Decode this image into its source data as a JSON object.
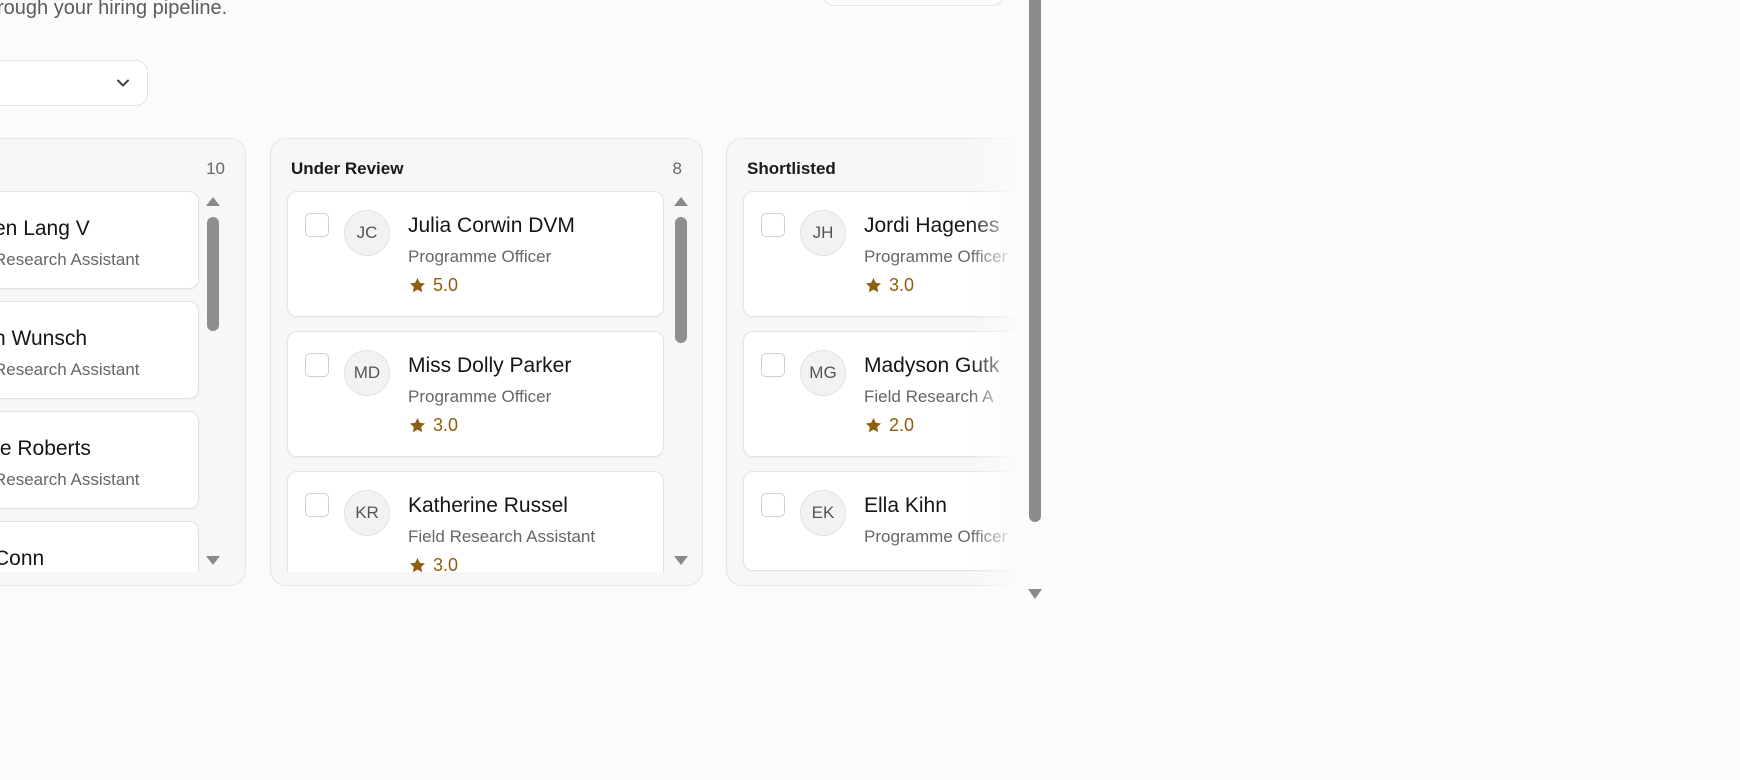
{
  "header": {
    "subtitle": "rough your hiring pipeline."
  },
  "columns": [
    {
      "title": "",
      "count": "10",
      "cards": [
        {
          "name": "en Lang V",
          "role": "Research Assistant"
        },
        {
          "name": "n Wunsch",
          "role": "Research Assistant"
        },
        {
          "name": "te Roberts",
          "role": "Research Assistant"
        },
        {
          "name": " Conn",
          "role": ""
        }
      ]
    },
    {
      "title": "Under Review",
      "count": "8",
      "cards": [
        {
          "initials": "JC",
          "name": "Julia Corwin DVM",
          "role": "Programme Officer",
          "rating": "5.0"
        },
        {
          "initials": "MD",
          "name": "Miss Dolly Parker",
          "role": "Programme Officer",
          "rating": "3.0"
        },
        {
          "initials": "KR",
          "name": "Katherine Russel",
          "role": "Field Research Assistant",
          "rating": "3.0"
        }
      ]
    },
    {
      "title": "Shortlisted",
      "count": "",
      "cards": [
        {
          "initials": "JH",
          "name": "Jordi Hagenes",
          "role": "Programme Officer",
          "rating": "3.0"
        },
        {
          "initials": "MG",
          "name": "Madyson Gutk",
          "role": "Field Research A",
          "rating": "2.0"
        },
        {
          "initials": "EK",
          "name": "Ella Kihn",
          "role": "Programme Officer"
        }
      ]
    }
  ],
  "icons": {
    "filter_chevron": "chevron-down-icon",
    "rating": "star-icon"
  },
  "colors": {
    "rating": "#8f5e0e",
    "background": "#fbfbfb"
  }
}
